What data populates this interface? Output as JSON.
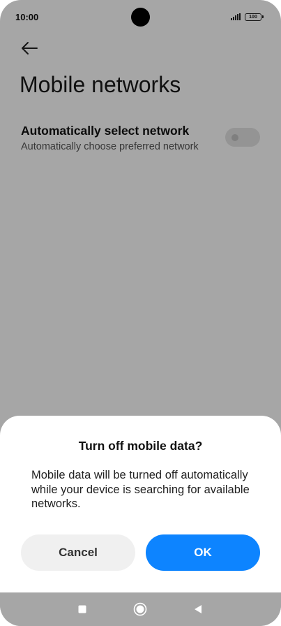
{
  "status_bar": {
    "time": "10:00",
    "battery": "100",
    "icons": [
      "signal-icon",
      "battery-icon"
    ]
  },
  "header": {
    "back_icon": "arrow-left-icon",
    "title": "Mobile networks"
  },
  "settings": {
    "auto_select": {
      "title": "Automatically select network",
      "subtitle": "Automatically choose preferred network",
      "enabled": false
    }
  },
  "dialog": {
    "title": "Turn off mobile data?",
    "message": "Mobile data will be turned off automatically while your device is searching for available networks.",
    "cancel_label": "Cancel",
    "ok_label": "OK"
  },
  "nav_bar": {
    "icons": [
      "recents-square-icon",
      "home-circle-icon",
      "back-triangle-icon"
    ]
  },
  "colors": {
    "accent": "#0d84ff",
    "scrim": "rgba(0,0,0,0.35)",
    "cancel_bg": "#f0f0f0",
    "nav_bg": "#a6a6a6"
  }
}
